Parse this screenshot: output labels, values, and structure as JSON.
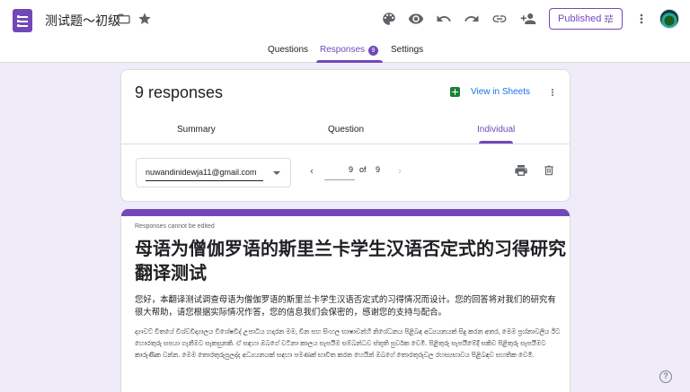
{
  "app": {
    "doc_title": "测试题～初级",
    "published_label": "Published"
  },
  "tabs": [
    {
      "label": "Questions"
    },
    {
      "label": "Responses",
      "badge": "9"
    },
    {
      "label": "Settings"
    }
  ],
  "responses_card": {
    "count_label": "9 responses",
    "view_in_sheets": "View in Sheets",
    "subtabs": [
      "Summary",
      "Question",
      "Individual"
    ],
    "email": "nuwandinidewja11@gmail.com",
    "current": "9",
    "of_label": "of",
    "total": "9"
  },
  "form": {
    "notice": "Responses cannot be edited",
    "title": "母语为僧伽罗语的斯里兰卡学生汉语否定式的习得研究翻译测试",
    "description_zh": "您好，本翻译测试调查母语为僧伽罗语的斯里兰卡学生汉语否定式的习得情况而设计。您的回答将对我们的研究有很大帮助，请您根据实际情况作答，您的信息我们会保密的，感谢您的支持与配合。",
    "description_si": "ද්‍යාවට් වීතයේ විශ්වවිද්‍යාලය විශේෂවිද් උපාධිය හදාරන මම, චීන සහ සිංහල භාෂාවන්හි නිශේධනය පිළිබඳ අධ්‍යයනයක් සිදු කරන අතර, මෙම ප්‍රශ්නාවලිය ඊට හොරතුරු සපයා ගැනීමට සැකසුනකි. ඒ සඳහා ඔබගේ වටිනා කාලය සැපයීම සම්බන්ධව ස්තූති පුර්වක වෙමි. පිළිතුරු සැපයීමේදී සකිව පිළිතුරු සැපයීමට කාරුණික වන්න. මෙම තොරතුරුපුලද්ද අධ්‍යයනයක් සඳහා පමණක් භාවිත කරන හෙයින් ඔබගේ තොරතුරුවල රහස්‍යභාවය පිළිබඳව සහතික වෙමි."
  },
  "colors": {
    "accent": "#7248b9",
    "background": "#f0ebf8",
    "sheets_green": "#188038",
    "link_blue": "#1a73e8"
  }
}
